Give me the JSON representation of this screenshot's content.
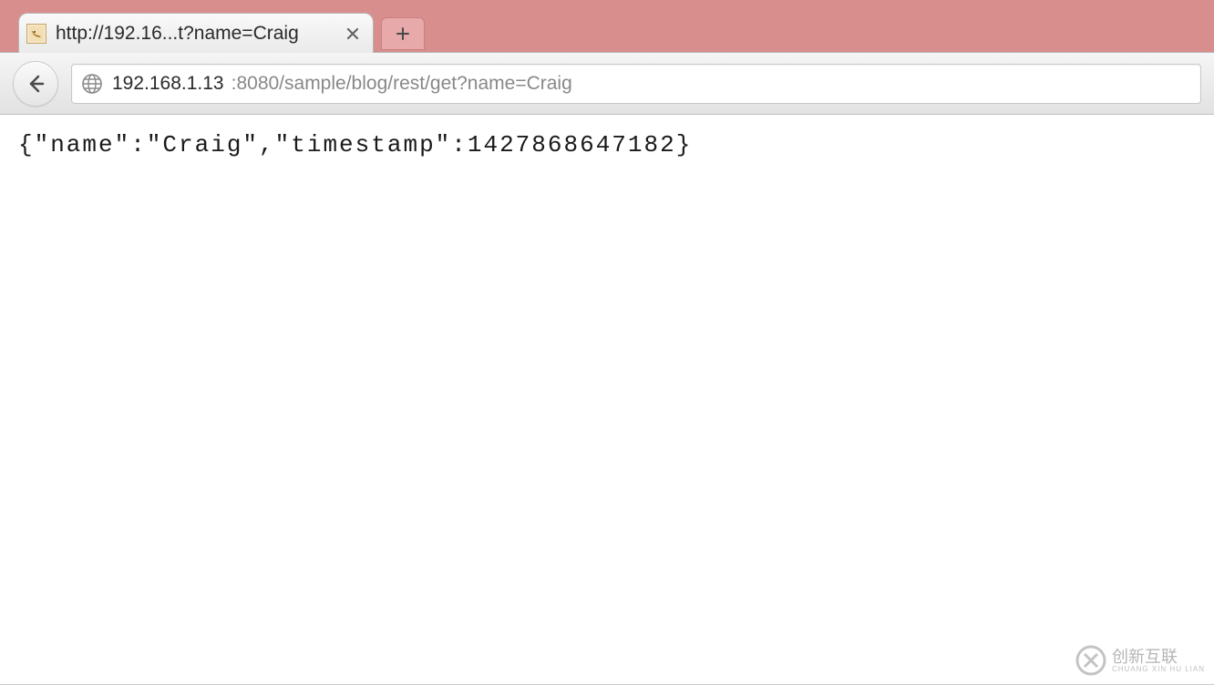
{
  "tab": {
    "title": "http://192.16...t?name=Craig",
    "favicon_semantic": "tomcat-icon"
  },
  "toolbar": {
    "back_semantic": "back-arrow-icon",
    "globe_semantic": "globe-icon"
  },
  "url": {
    "host": "192.168.1.13",
    "path": ":8080/sample/blog/rest/get?name=Craig"
  },
  "content": {
    "body": "{\"name\":\"Craig\",\"timestamp\":1427868647182}"
  },
  "watermark": {
    "text": "创新互联",
    "sub": "CHUANG XIN HU LIAN"
  }
}
